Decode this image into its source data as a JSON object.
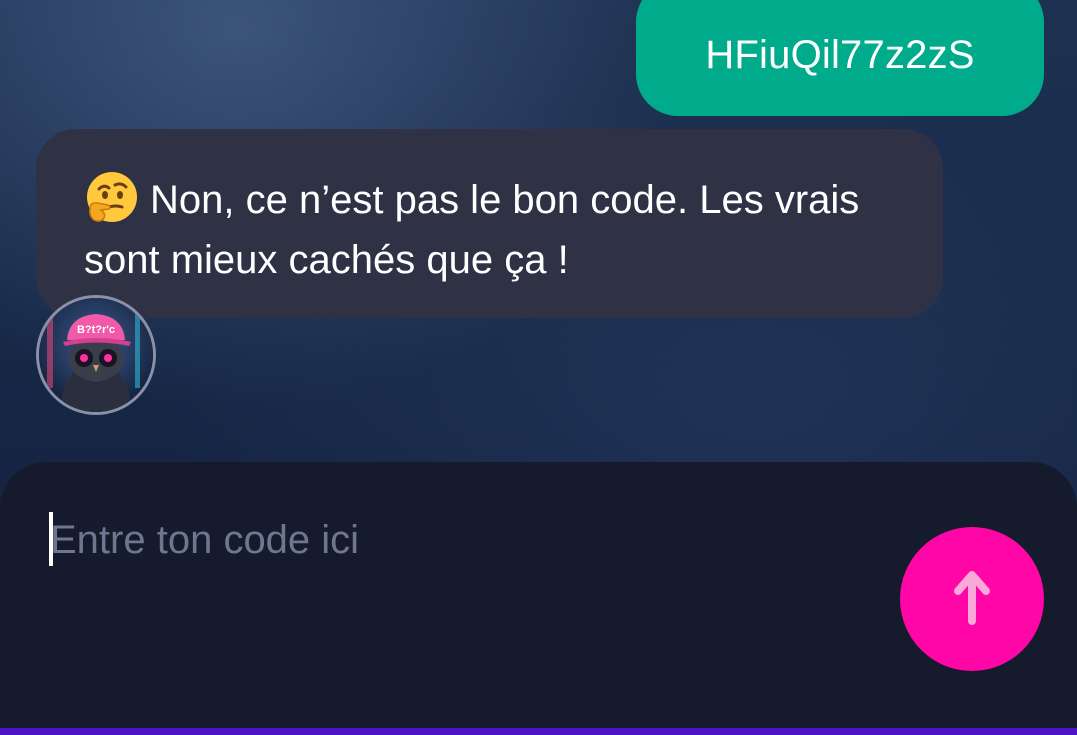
{
  "chat": {
    "user_message": "HFiuQil77z2zS",
    "bot_message": {
      "emoji_icon": "thinking-face-icon",
      "text": "Non, ce n’est pas le bon code. Les vrais sont mieux cachés que ça !"
    },
    "bot_avatar": {
      "icon": "owl-with-cap-avatar",
      "cap_text": "B?t?r'c"
    }
  },
  "composer": {
    "placeholder": "Entre ton code ici",
    "value": "",
    "send_icon": "arrow-up-icon"
  },
  "colors": {
    "user_bubble": "#00ab8b",
    "bot_bubble": "#2f3144",
    "send_button": "#ff06a6",
    "input_panel": "#151a2c",
    "bottom_bar": "#4c14c8"
  }
}
